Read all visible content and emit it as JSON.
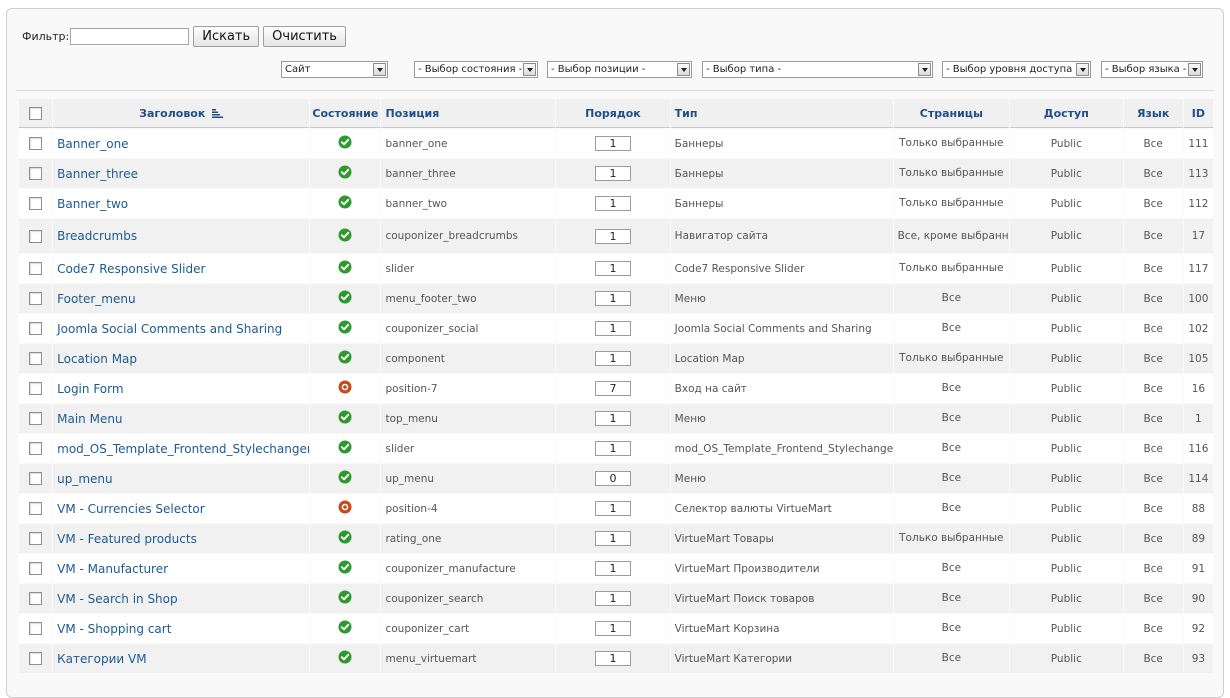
{
  "filter": {
    "label": "Фильтр:",
    "value": "",
    "search_button": "Искать",
    "clear_button": "Очистить"
  },
  "selects": {
    "site": "Сайт",
    "state": "- Выбор состояния -",
    "position": "- Выбор позиции -",
    "type": "- Выбор типа -",
    "access": "- Выбор уровня доступа -",
    "language": "- Выбор языка -"
  },
  "columns": {
    "title": "Заголовок",
    "state": "Состояние",
    "position": "Позиция",
    "order": "Порядок",
    "type": "Тип",
    "pages": "Страницы",
    "access": "Доступ",
    "language": "Язык",
    "id": "ID"
  },
  "colors": {
    "published": "#2e9a2e",
    "unpublished": "#c84a1c",
    "link": "#1c5a95"
  },
  "rows": [
    {
      "title": "Banner_one",
      "state": "published",
      "position": "banner_one",
      "order": "1",
      "type": "Баннеры",
      "pages": "Только выбранные",
      "access": "Public",
      "language": "Все",
      "id": "111"
    },
    {
      "title": "Banner_three",
      "state": "published",
      "position": "banner_three",
      "order": "1",
      "type": "Баннеры",
      "pages": "Только выбранные",
      "access": "Public",
      "language": "Все",
      "id": "113"
    },
    {
      "title": "Banner_two",
      "state": "published",
      "position": "banner_two",
      "order": "1",
      "type": "Баннеры",
      "pages": "Только выбранные",
      "access": "Public",
      "language": "Все",
      "id": "112"
    },
    {
      "title": "Breadcrumbs",
      "state": "published",
      "position": "couponizer_breadcrumbs",
      "order": "1",
      "type": "Навигатор сайта",
      "pages": "Все, кроме выбранных",
      "access": "Public",
      "language": "Все",
      "id": "17"
    },
    {
      "title": "Code7 Responsive Slider",
      "state": "published",
      "position": "slider",
      "order": "1",
      "type": "Code7 Responsive Slider",
      "pages": "Только выбранные",
      "access": "Public",
      "language": "Все",
      "id": "117"
    },
    {
      "title": "Footer_menu",
      "state": "published",
      "position": "menu_footer_two",
      "order": "1",
      "type": "Меню",
      "pages": "Все",
      "access": "Public",
      "language": "Все",
      "id": "100"
    },
    {
      "title": "Joomla Social Comments and Sharing",
      "state": "published",
      "position": "couponizer_social",
      "order": "1",
      "type": "Joomla Social Comments and Sharing",
      "pages": "Все",
      "access": "Public",
      "language": "Все",
      "id": "102"
    },
    {
      "title": "Location Map",
      "state": "published",
      "position": "component",
      "order": "1",
      "type": "Location Map",
      "pages": "Только выбранные",
      "access": "Public",
      "language": "Все",
      "id": "105"
    },
    {
      "title": "Login Form",
      "state": "unpublished",
      "position": "position-7",
      "order": "7",
      "type": "Вход на сайт",
      "pages": "Все",
      "access": "Public",
      "language": "Все",
      "id": "16"
    },
    {
      "title": "Main Menu",
      "state": "published",
      "position": "top_menu",
      "order": "1",
      "type": "Меню",
      "pages": "Все",
      "access": "Public",
      "language": "Все",
      "id": "1"
    },
    {
      "title": "mod_OS_Template_Frontend_Stylechanger",
      "state": "published",
      "position": "slider",
      "order": "1",
      "type": "mod_OS_Template_Frontend_Stylechanger",
      "pages": "Все",
      "access": "Public",
      "language": "Все",
      "id": "116"
    },
    {
      "title": "up_menu",
      "state": "published",
      "position": "up_menu",
      "order": "0",
      "type": "Меню",
      "pages": "Все",
      "access": "Public",
      "language": "Все",
      "id": "114"
    },
    {
      "title": "VM - Currencies Selector",
      "state": "unpublished",
      "position": "position-4",
      "order": "1",
      "type": "Селектор валюты VirtueMart",
      "pages": "Все",
      "access": "Public",
      "language": "Все",
      "id": "88"
    },
    {
      "title": "VM - Featured products",
      "state": "published",
      "position": "rating_one",
      "order": "1",
      "type": "VirtueMart Товары",
      "pages": "Только выбранные",
      "access": "Public",
      "language": "Все",
      "id": "89"
    },
    {
      "title": "VM - Manufacturer",
      "state": "published",
      "position": "couponizer_manufacture",
      "order": "1",
      "type": "VirtueMart Производители",
      "pages": "Все",
      "access": "Public",
      "language": "Все",
      "id": "91"
    },
    {
      "title": "VM - Search in Shop",
      "state": "published",
      "position": "couponizer_search",
      "order": "1",
      "type": "VirtueMart Поиск товаров",
      "pages": "Все",
      "access": "Public",
      "language": "Все",
      "id": "90"
    },
    {
      "title": "VM - Shopping cart",
      "state": "published",
      "position": "couponizer_cart",
      "order": "1",
      "type": "VirtueMart Корзина",
      "pages": "Все",
      "access": "Public",
      "language": "Все",
      "id": "92"
    },
    {
      "title": "Категории VM",
      "state": "published",
      "position": "menu_virtuemart",
      "order": "1",
      "type": "VirtueMart Категории",
      "pages": "Все",
      "access": "Public",
      "language": "Все",
      "id": "93"
    }
  ]
}
